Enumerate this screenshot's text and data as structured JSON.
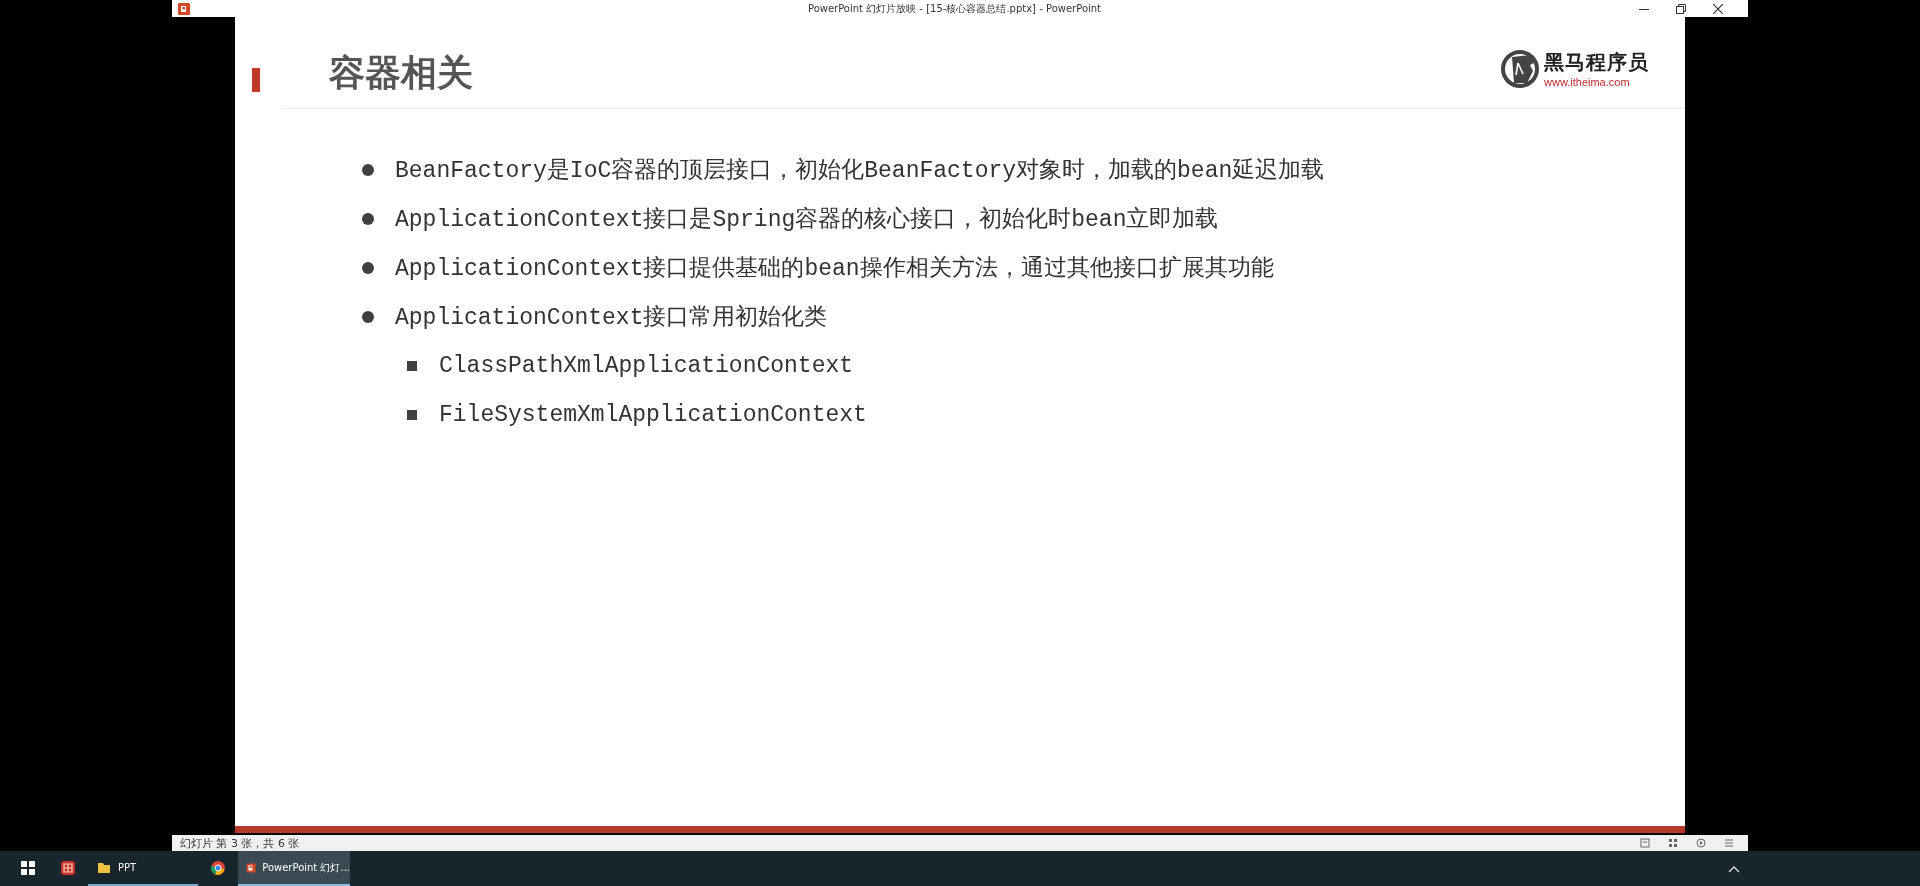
{
  "window": {
    "title": "PowerPoint 幻灯片放映 - [15-核心容器总结.pptx] - PowerPoint"
  },
  "slide": {
    "title": "容器相关",
    "logo": {
      "name": "黑马程序员",
      "url": "www.itheima.com"
    },
    "bullets": [
      {
        "text": "BeanFactory是IoC容器的顶层接口，初始化BeanFactory对象时，加载的bean延迟加载"
      },
      {
        "text": "ApplicationContext接口是Spring容器的核心接口，初始化时bean立即加载"
      },
      {
        "text": "ApplicationContext接口提供基础的bean操作相关方法，通过其他接口扩展其功能"
      },
      {
        "text": "ApplicationContext接口常用初始化类",
        "children": [
          {
            "text": "ClassPathXmlApplicationContext"
          },
          {
            "text": "FileSystemXmlApplicationContext"
          }
        ]
      }
    ]
  },
  "status_bar": {
    "text": "幻灯片 第 3 张，共 6 张"
  },
  "taskbar": {
    "items": [
      {
        "kind": "start",
        "selected": false
      },
      {
        "kind": "app",
        "selected": false
      },
      {
        "kind": "folder",
        "label": "PPT",
        "selected": false
      },
      {
        "kind": "browser",
        "selected": false
      },
      {
        "kind": "powerpoint",
        "label": "PowerPoint 幻灯...",
        "selected": true
      }
    ]
  }
}
